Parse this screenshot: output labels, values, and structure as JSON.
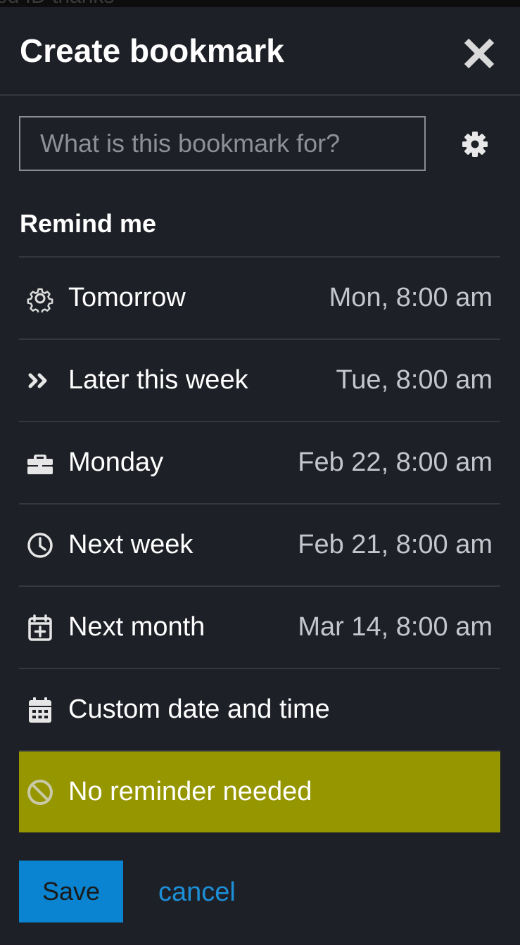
{
  "background": {
    "partial_text": "ed ID thanks"
  },
  "modal": {
    "title": "Create bookmark",
    "close_icon": "close-icon",
    "input": {
      "value": "",
      "placeholder": "What is this bookmark for?"
    },
    "settings_icon": "gear-icon",
    "remind_title": "Remind me",
    "options": [
      {
        "icon": "gear-outline-icon",
        "label": "Tomorrow",
        "time": "Mon, 8:00 am"
      },
      {
        "icon": "double-chevron-right-icon",
        "label": "Later this week",
        "time": "Tue, 8:00 am"
      },
      {
        "icon": "briefcase-icon",
        "label": "Monday",
        "time": "Feb 22, 8:00 am"
      },
      {
        "icon": "clock-icon",
        "label": "Next week",
        "time": "Feb 21, 8:00 am"
      },
      {
        "icon": "calendar-plus-icon",
        "label": "Next month",
        "time": "Mar 14, 8:00 am"
      },
      {
        "icon": "calendar-icon",
        "label": "Custom date and time",
        "time": ""
      },
      {
        "icon": "ban-icon",
        "label": "No reminder needed",
        "time": "",
        "selected": true
      }
    ],
    "save_label": "Save",
    "cancel_label": "cancel"
  },
  "colors": {
    "modal_bg": "#1e2027",
    "selected_bg": "#969600",
    "save_bg": "#0a84d0",
    "link": "#1d8fd6"
  }
}
